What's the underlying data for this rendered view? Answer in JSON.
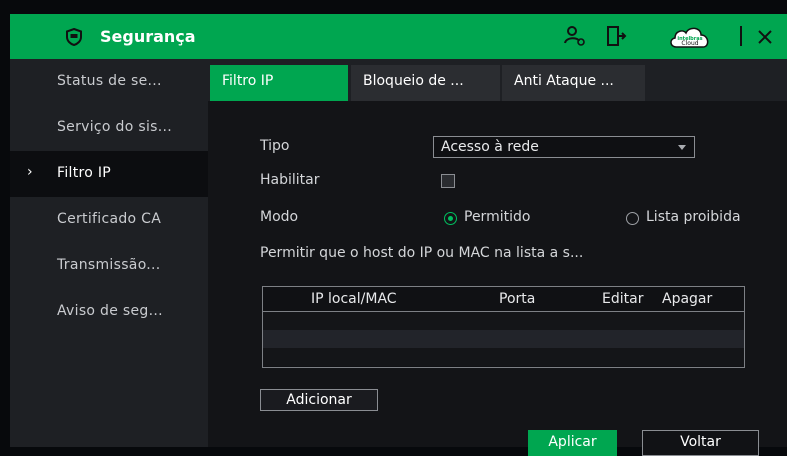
{
  "titlebar": {
    "title": "Segurança",
    "cloud_label": "Intelbras Cloud",
    "brand_color": "#00a650"
  },
  "sidebar": {
    "items": [
      {
        "label": "Status de se..."
      },
      {
        "label": "Serviço do sis..."
      },
      {
        "label": "Filtro IP",
        "active": true
      },
      {
        "label": "Certificado CA"
      },
      {
        "label": "Transmissão..."
      },
      {
        "label": "Aviso de seg..."
      }
    ],
    "active_marker": "›"
  },
  "tabs": [
    {
      "label": "Filtro IP",
      "active": true
    },
    {
      "label": "Bloqueio de ..."
    },
    {
      "label": "Anti Ataque ..."
    }
  ],
  "form": {
    "tipo_label": "Tipo",
    "tipo_value": "Acesso à rede",
    "habilitar_label": "Habilitar",
    "habilitar_checked": false,
    "modo_label": "Modo",
    "modo_options": [
      "Permitido",
      "Lista proibida"
    ],
    "modo_selected": "Permitido",
    "description": "Permitir que o host do IP ou MAC na lista a s..."
  },
  "table": {
    "headers": [
      "IP local/MAC",
      "Porta",
      "Editar",
      "Apagar"
    ],
    "rows": []
  },
  "buttons": {
    "add": "Adicionar",
    "apply": "Aplicar",
    "back": "Voltar"
  }
}
